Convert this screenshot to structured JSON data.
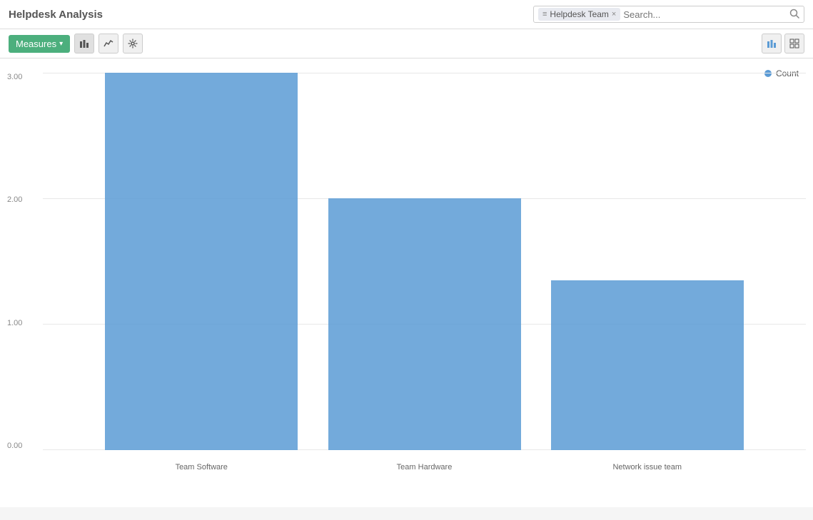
{
  "header": {
    "title": "Helpdesk Analysis",
    "filter_tag": {
      "icon": "≡",
      "label": "Helpdesk Team",
      "close": "×"
    },
    "search_placeholder": "Search...",
    "search_icon": "🔍"
  },
  "toolbar": {
    "measures_label": "Measures",
    "measures_arrow": "▾",
    "bar_chart_icon": "📊",
    "line_chart_icon": "📈",
    "settings_icon": "⚙",
    "view_bar_icon": "📊",
    "view_table_icon": "▦"
  },
  "chart": {
    "legend_label": "Count",
    "legend_color": "#5b9bd5",
    "y_axis": [
      "0.00",
      "1.00",
      "2.00",
      "3.00"
    ],
    "bars": [
      {
        "label": "Team Software",
        "value": 3,
        "max": 3
      },
      {
        "label": "Team Hardware",
        "value": 2,
        "max": 3
      },
      {
        "label": "Network issue team",
        "value": 1.35,
        "max": 3
      }
    ]
  }
}
